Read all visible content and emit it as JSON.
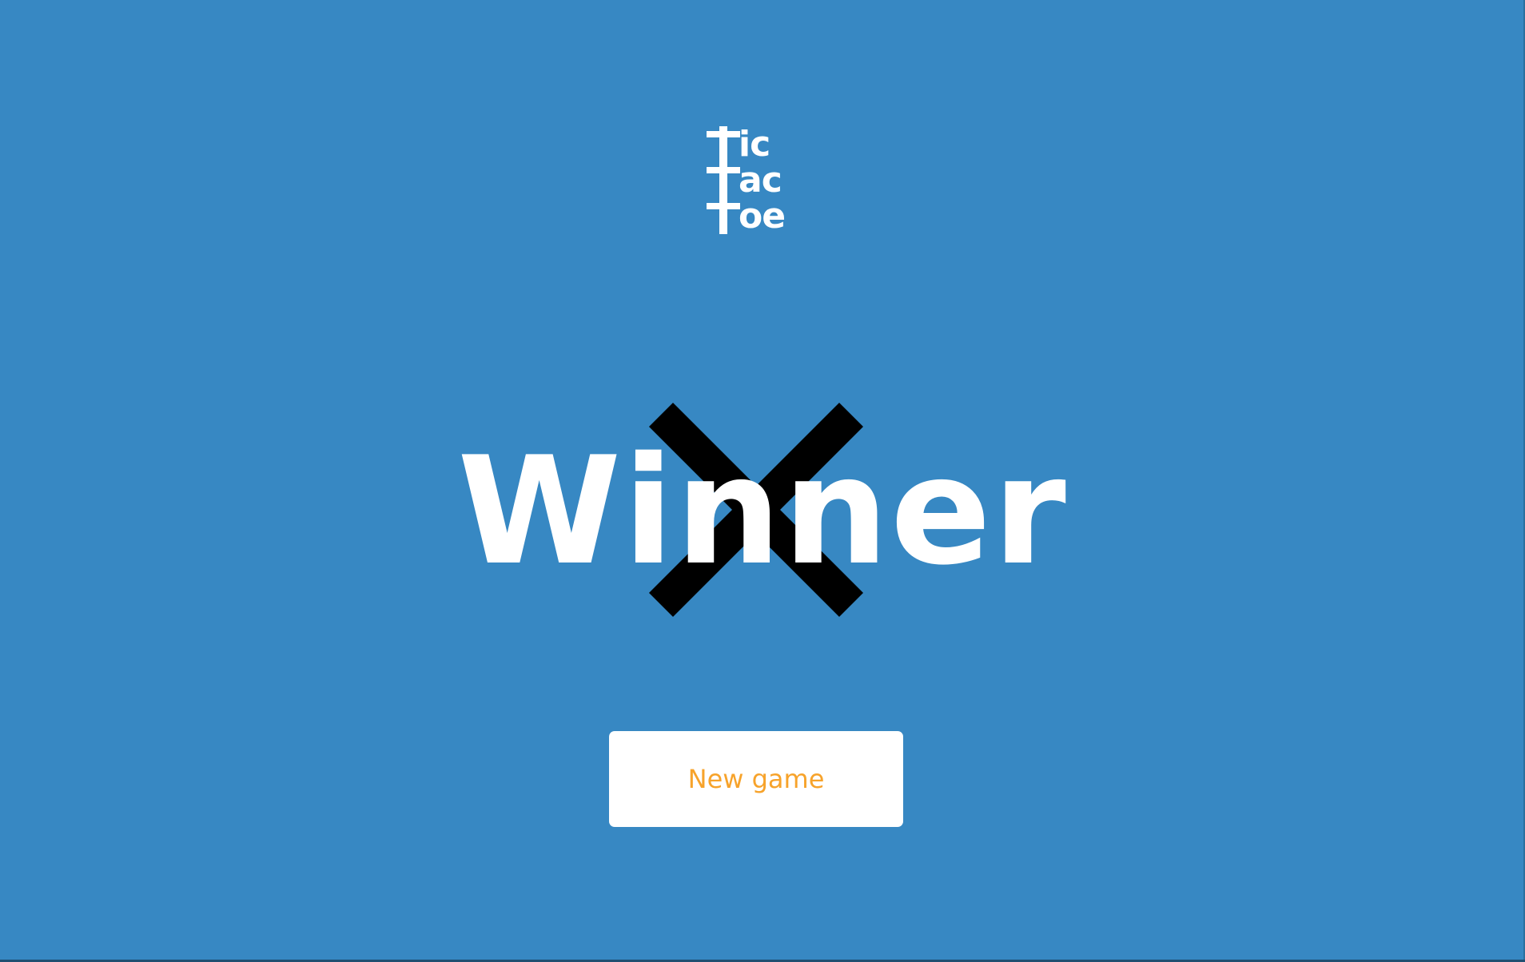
{
  "colors": {
    "background": "#3788c3",
    "logo": "#ffffff",
    "winner_text": "#ffffff",
    "winner_mark": "#000000",
    "button_bg": "#ffffff",
    "button_text": "#f7a32b"
  },
  "logo": {
    "lines": [
      {
        "initial": "T",
        "rest": "ic"
      },
      {
        "initial": "T",
        "rest": "ac"
      },
      {
        "initial": "T",
        "rest": "oe"
      }
    ]
  },
  "result": {
    "winner_symbol": "X",
    "winner_mark_icon": "x-mark-icon",
    "text": "Winner"
  },
  "actions": {
    "new_game_label": "New game"
  }
}
